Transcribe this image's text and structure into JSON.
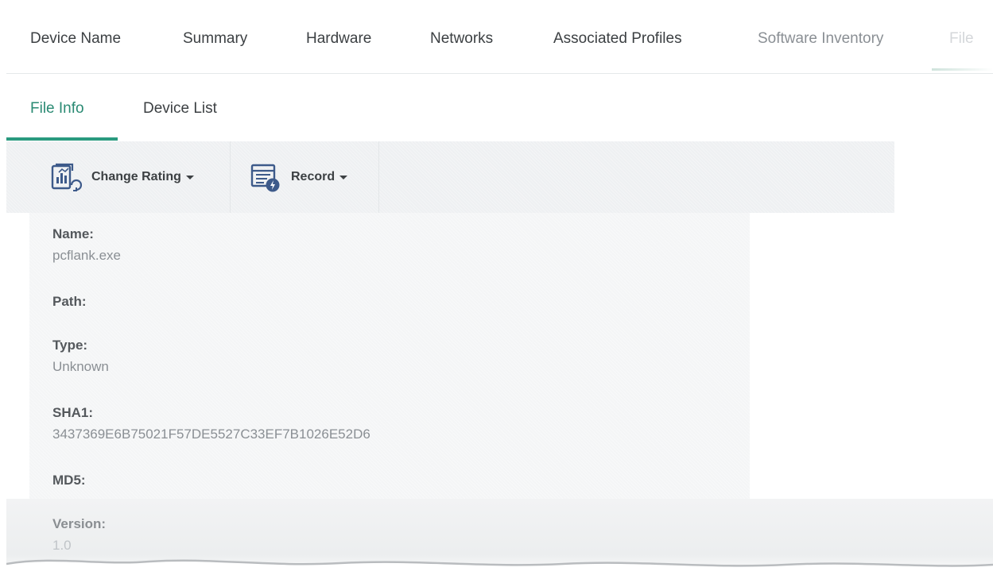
{
  "top_tabs": [
    {
      "label": "Device Name"
    },
    {
      "label": "Summary"
    },
    {
      "label": "Hardware"
    },
    {
      "label": "Networks"
    },
    {
      "label": "Associated Profiles"
    },
    {
      "label": "Software Inventory"
    },
    {
      "label": "File"
    }
  ],
  "sub_tabs": [
    {
      "label": "File Info",
      "active": true
    },
    {
      "label": "Device List",
      "active": false
    }
  ],
  "toolbar": {
    "change_rating_label": "Change Rating",
    "record_label": "Record",
    "change_rating_icon": "chart-refresh-icon",
    "record_icon": "list-lightning-icon"
  },
  "file_info": {
    "name_label": "Name:",
    "name_value": "pcflank.exe",
    "path_label": "Path:",
    "path_value": "",
    "type_label": "Type:",
    "type_value": "Unknown",
    "sha1_label": "SHA1:",
    "sha1_value": "3437369E6B75021F57DE5527C33EF7B1026E52D6",
    "md5_label": "MD5:",
    "md5_value": "",
    "version_label": "Version:",
    "version_value": "1.0"
  },
  "colors": {
    "accent": "#2a9a7f",
    "text_dark": "#3c4043",
    "text_muted": "#8a8f94",
    "icon_blue": "#3d5a8a"
  }
}
